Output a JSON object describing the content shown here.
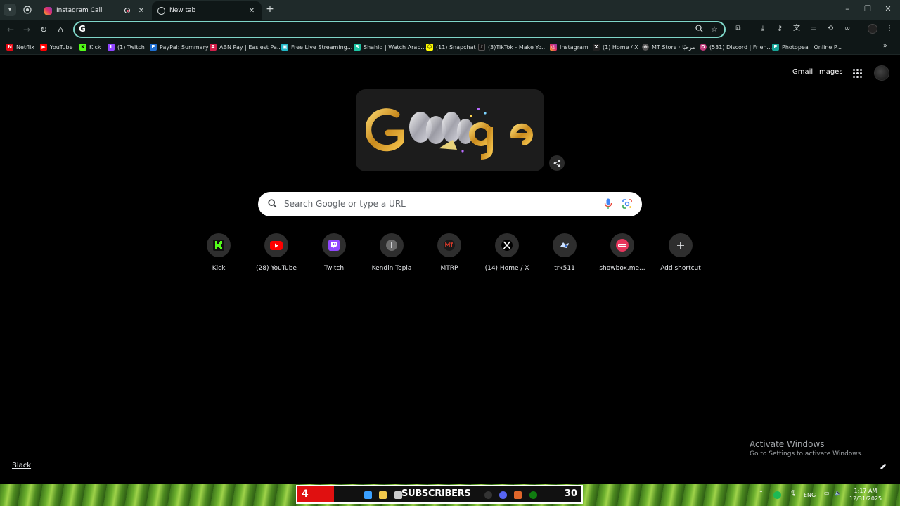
{
  "tabs": [
    {
      "title": "Instagram Call",
      "active": false
    },
    {
      "title": "New tab",
      "active": true
    }
  ],
  "bookmarks": [
    {
      "label": "Netflix",
      "icon": "netflix-icon",
      "color": "#e50914"
    },
    {
      "label": "YouTube",
      "icon": "youtube-icon",
      "color": "#ff0000"
    },
    {
      "label": "Kick",
      "icon": "kick-icon",
      "color": "#53fc18"
    },
    {
      "label": "(1) Twitch",
      "icon": "twitch-icon",
      "color": "#9146ff"
    },
    {
      "label": "PayPal: Summary",
      "icon": "paypal-icon",
      "color": "#1f6fd1"
    },
    {
      "label": "ABN Pay | Easiest Pa...",
      "icon": "abn-icon",
      "color": "#d21f4a"
    },
    {
      "label": "Free Live Streaming...",
      "icon": "stream-icon",
      "color": "#22b8c8"
    },
    {
      "label": "Shahid | Watch Arab...",
      "icon": "shahid-icon",
      "color": "#1ec7a6"
    },
    {
      "label": "(11) Snapchat",
      "icon": "snapchat-icon",
      "color": "#fffc00"
    },
    {
      "label": "(3)TikTok - Make Yo...",
      "icon": "tiktok-icon",
      "color": "#111111"
    },
    {
      "label": "Instagram",
      "icon": "instagram-icon",
      "color": "#e1306c"
    },
    {
      "label": "(1) Home / X",
      "icon": "x-icon",
      "color": "#222222"
    },
    {
      "label": "MT Store · مرحبًا",
      "icon": "globe-icon",
      "color": "#555555"
    },
    {
      "label": "(531) Discord | Frien...",
      "icon": "discord-icon",
      "color": "#c0397a"
    },
    {
      "label": "Photopea | Online P...",
      "icon": "photopea-icon",
      "color": "#18a497"
    }
  ],
  "top_links": {
    "gmail": "Gmail",
    "images": "Images"
  },
  "search": {
    "placeholder": "Search Google or type a URL"
  },
  "shortcuts": [
    {
      "label": "Kick",
      "icon": "kick-icon",
      "color": "#53fc18"
    },
    {
      "label": "(28) YouTube",
      "icon": "youtube-icon",
      "color": "#ff0000"
    },
    {
      "label": "Twitch",
      "icon": "twitch-icon",
      "color": "#9146ff"
    },
    {
      "label": "Kendin Topla",
      "icon": "letter-i-icon",
      "color": "#6b6b6b"
    },
    {
      "label": "MTRP",
      "icon": "mtrp-icon",
      "color": "#1a1a1a"
    },
    {
      "label": "(14) Home / X",
      "icon": "x-icon",
      "color": "#000000"
    },
    {
      "label": "trk511",
      "icon": "trk511-icon",
      "color": "#3a3a3a"
    },
    {
      "label": "showbox.me...",
      "icon": "showbox-icon",
      "color": "#e8365d"
    },
    {
      "label": "Add shortcut",
      "icon": "plus-icon",
      "color": "#3a3a3a"
    }
  ],
  "activation": {
    "title": "Activate Windows",
    "subtitle": "Go to Settings to activate Windows."
  },
  "theme_link": "Black",
  "taskbar": {
    "subs_count": "4",
    "subs_label": "SUBSCRIBERS",
    "subs_goal": "30",
    "language": "ENG",
    "time": "1:17 AM",
    "date": "12/31/2025"
  }
}
